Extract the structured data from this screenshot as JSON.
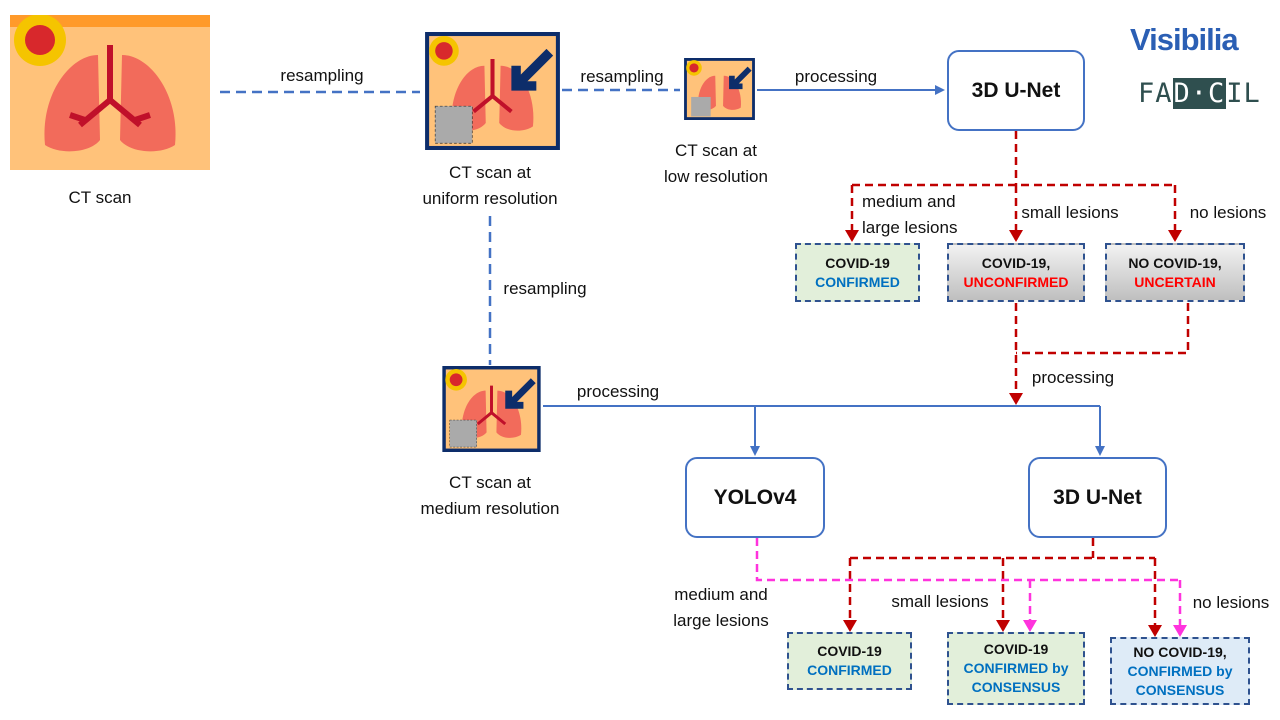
{
  "logos": {
    "visibilia": "Visibilia",
    "fadcil": "FADCIL"
  },
  "inputs": {
    "ct": "CT scan",
    "uniform": [
      "CT scan at",
      "uniform resolution"
    ],
    "low": [
      "CT scan at",
      "low resolution"
    ],
    "medium": [
      "CT scan at",
      "medium resolution"
    ]
  },
  "edges": {
    "resampling": "resampling",
    "processing": "processing",
    "medium_large": [
      "medium and",
      "large lesions"
    ],
    "small": "small lesions",
    "none": "no lesions"
  },
  "models": {
    "unet_top": "3D U-Net",
    "yolo": "YOLOv4",
    "unet_bottom": "3D U-Net"
  },
  "results_top": [
    {
      "line1": "COVID-19",
      "line2": "CONFIRMED"
    },
    {
      "line1": "COVID-19,",
      "line2": "UNCONFIRMED"
    },
    {
      "line1": "NO COVID-19,",
      "line2": "UNCERTAIN"
    }
  ],
  "results_bottom": [
    {
      "line1": "COVID-19",
      "line2": "CONFIRMED"
    },
    {
      "line1": "COVID-19",
      "line2": "CONFIRMED by",
      "line3": "CONSENSUS"
    },
    {
      "line1": "NO COVID-19,",
      "line2": "CONFIRMED by",
      "line3": "CONSENSUS"
    }
  ],
  "colors": {
    "blue_line": "#4472c4",
    "red_line": "#c00000",
    "magenta_line": "#ff33dd",
    "confirmed_text": "#0070c0",
    "unconfirmed_text": "#ff0000"
  }
}
